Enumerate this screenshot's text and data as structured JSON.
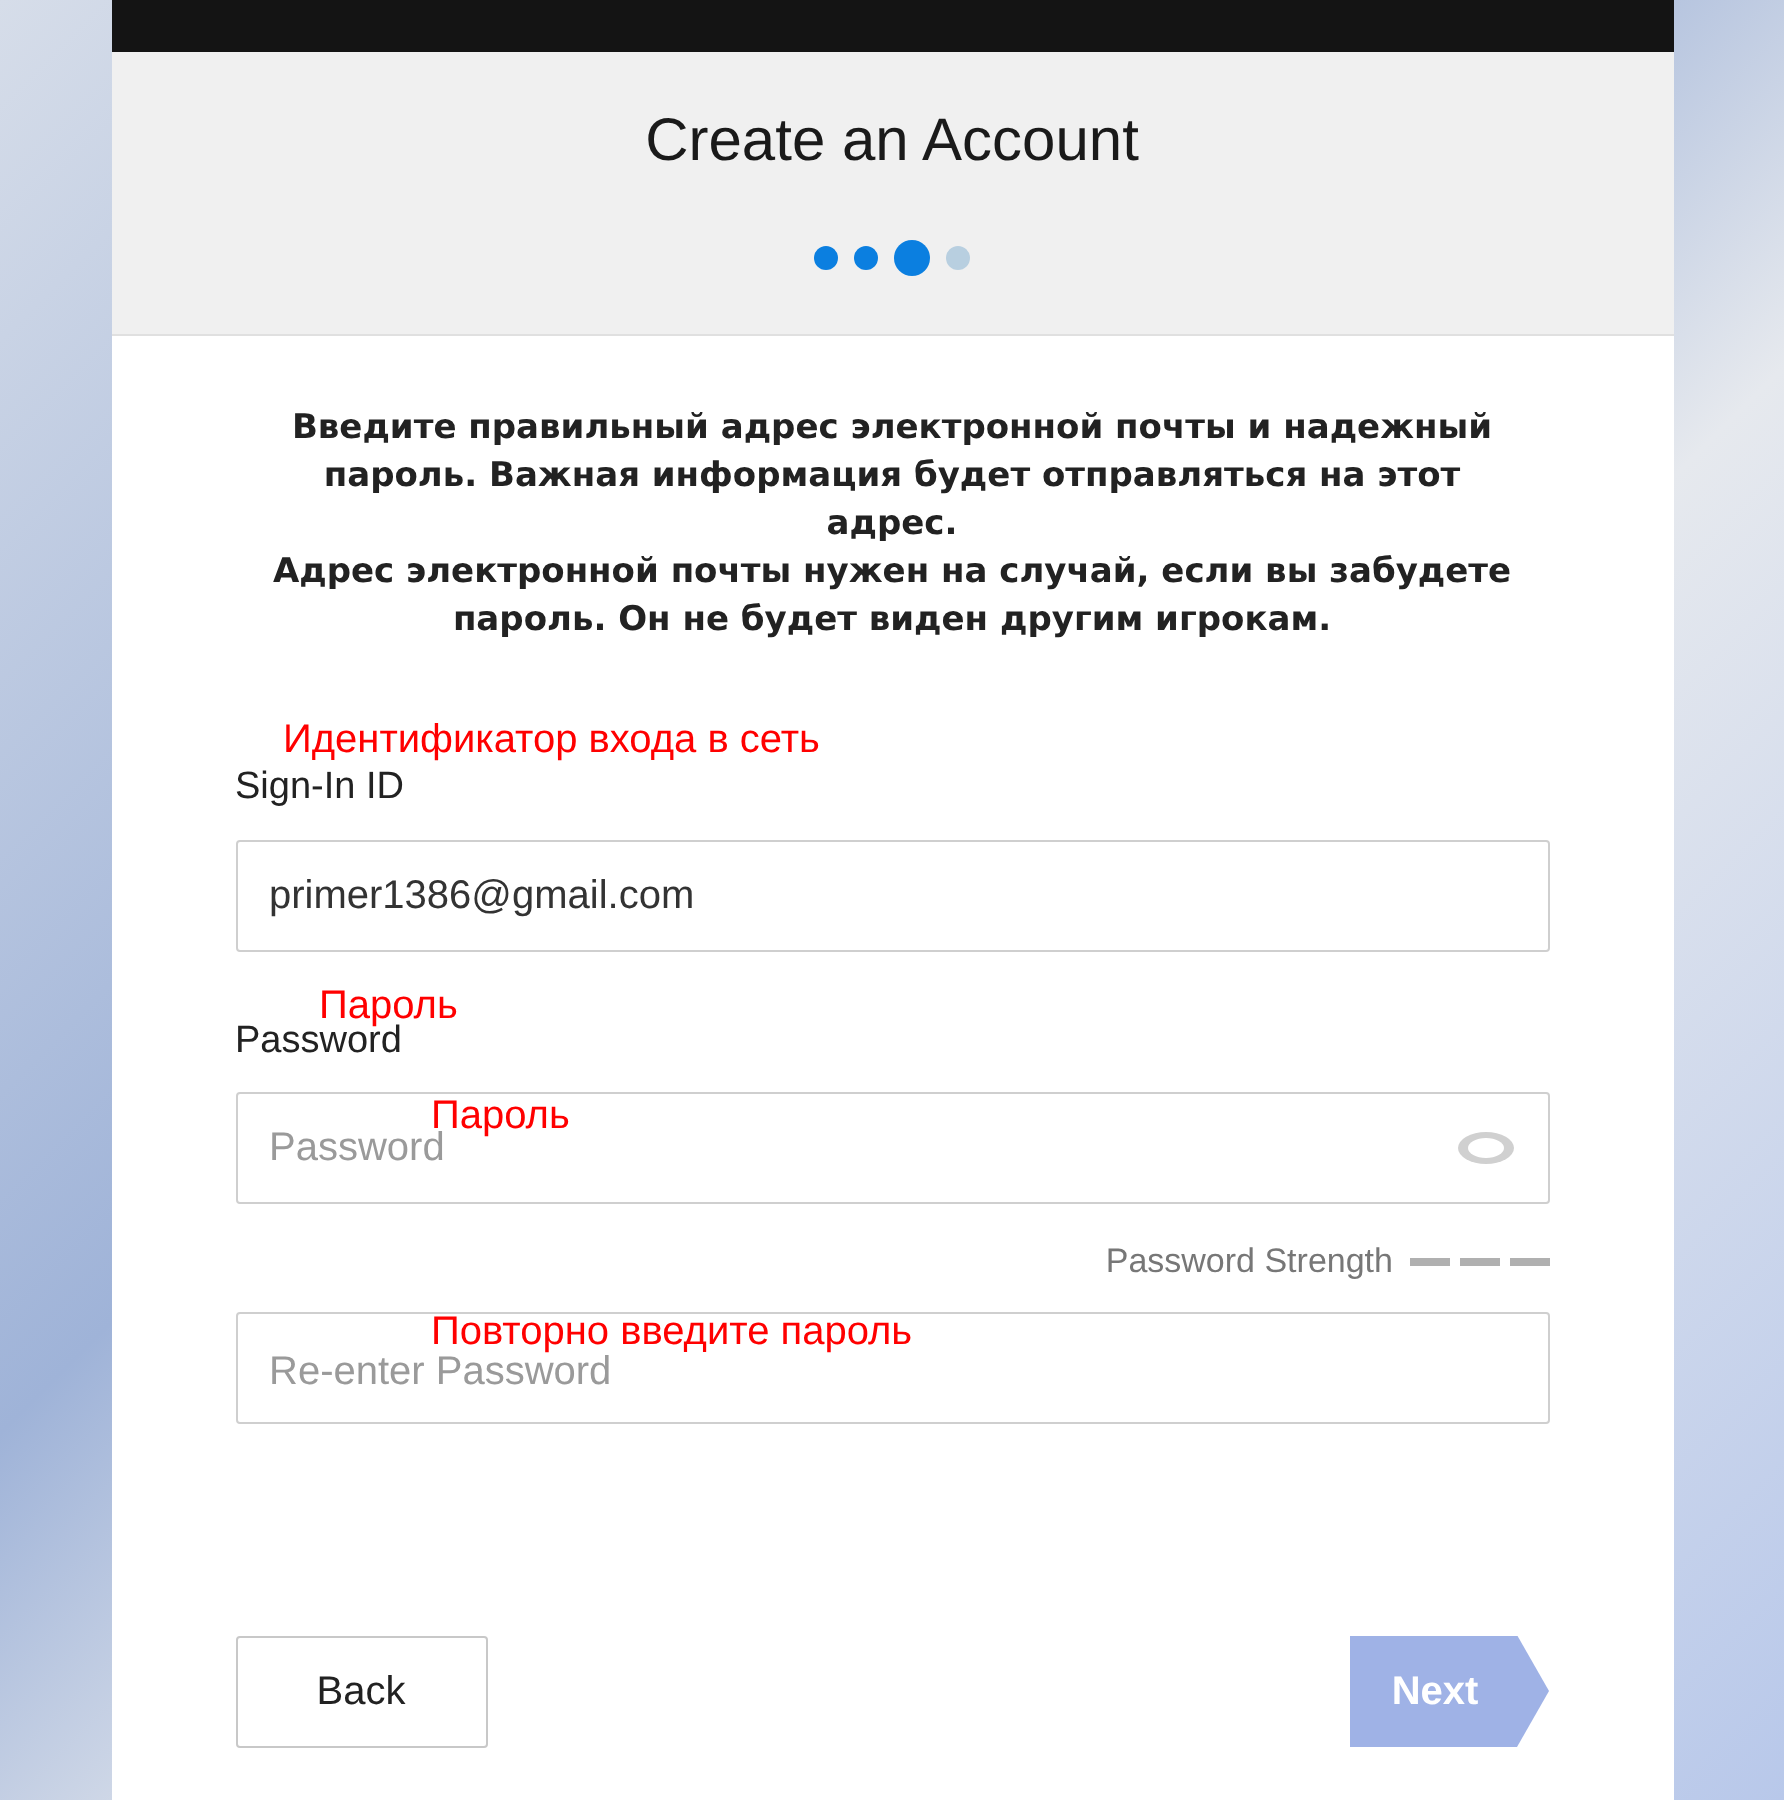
{
  "title": "Create an Account",
  "steps": [
    {
      "kind": "done"
    },
    {
      "kind": "done"
    },
    {
      "kind": "current"
    },
    {
      "kind": "todo"
    }
  ],
  "intro": [
    "Введите правильный адрес электронной почты и надежный пароль. Важная информация будет отправляться на этот адрес.",
    "Адрес электронной почты нужен на случай, если вы забудете пароль. Он не будет виден другим игрокам."
  ],
  "sign_in": {
    "annotation": "Идентификатор входа в сеть",
    "label": "Sign-In ID",
    "value": "primer1386@gmail.com"
  },
  "password": {
    "annotation": "Пароль",
    "label": "Password",
    "field_annotation": "Пароль",
    "placeholder": "Password",
    "strength_label": "Password Strength"
  },
  "reenter": {
    "annotation": "Повторно введите пароль",
    "placeholder": "Re-enter Password"
  },
  "buttons": {
    "back": "Back",
    "next": {
      "label": "Next",
      "disabled": true
    }
  }
}
